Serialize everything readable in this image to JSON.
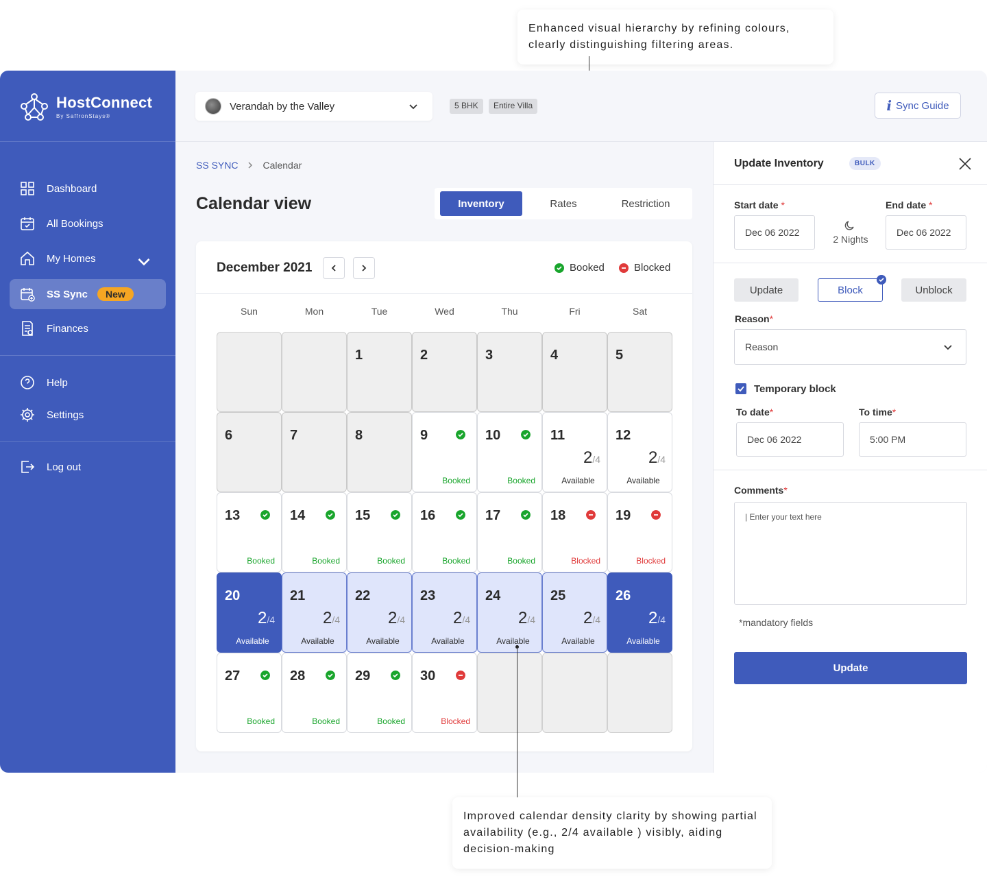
{
  "annotations": {
    "top": "Enhanced visual hierarchy by refining colours, clearly distinguishing filtering areas.",
    "bottom": "Improved calendar density clarity by showing partial availability (e.g., 2/4 available ) visibly, aiding decision-making"
  },
  "brand": {
    "name": "HostConnect",
    "sub": "By SaffronStays®"
  },
  "sidebar": {
    "items": [
      {
        "label": "Dashboard",
        "icon": "dashboard-icon"
      },
      {
        "label": "All Bookings",
        "icon": "calendar-check-icon"
      },
      {
        "label": "My Homes",
        "icon": "home-icon"
      },
      {
        "label": "SS Sync",
        "icon": "calendar-sync-icon",
        "badge": "New"
      },
      {
        "label": "Finances",
        "icon": "invoice-icon"
      },
      {
        "label": "Help",
        "icon": "help-icon"
      },
      {
        "label": "Settings",
        "icon": "gear-icon"
      },
      {
        "label": "Log out",
        "icon": "logout-icon"
      }
    ]
  },
  "topbar": {
    "property": "Verandah by the Valley",
    "tags": [
      "5 BHK",
      "Entire Villa"
    ],
    "sync_guide": "Sync Guide"
  },
  "breadcrumb": {
    "root": "SS SYNC",
    "current": "Calendar"
  },
  "page_title": "Calendar view",
  "tabs": [
    "Inventory",
    "Rates",
    "Restriction"
  ],
  "calendar": {
    "month": "December 2021",
    "legend": {
      "booked": "Booked",
      "blocked": "Blocked"
    },
    "weekdays": [
      "Sun",
      "Mon",
      "Tue",
      "Wed",
      "Thu",
      "Fri",
      "Sat"
    ],
    "cells": [
      {
        "t": "empty"
      },
      {
        "t": "empty"
      },
      {
        "t": "past",
        "d": "1"
      },
      {
        "t": "past",
        "d": "2"
      },
      {
        "t": "past",
        "d": "3"
      },
      {
        "t": "past",
        "d": "4"
      },
      {
        "t": "past",
        "d": "5"
      },
      {
        "t": "past",
        "d": "6"
      },
      {
        "t": "past",
        "d": "7"
      },
      {
        "t": "past",
        "d": "8"
      },
      {
        "t": "booked",
        "d": "9",
        "s": "Booked"
      },
      {
        "t": "booked",
        "d": "10",
        "s": "Booked"
      },
      {
        "t": "avail",
        "d": "11",
        "f": "2",
        "of": "4",
        "s": "Available"
      },
      {
        "t": "avail",
        "d": "12",
        "f": "2",
        "of": "4",
        "s": "Available"
      },
      {
        "t": "booked",
        "d": "13",
        "s": "Booked"
      },
      {
        "t": "booked",
        "d": "14",
        "s": "Booked"
      },
      {
        "t": "booked",
        "d": "15",
        "s": "Booked"
      },
      {
        "t": "booked",
        "d": "16",
        "s": "Booked"
      },
      {
        "t": "booked",
        "d": "17",
        "s": "Booked"
      },
      {
        "t": "blocked",
        "d": "18",
        "s": "Blocked"
      },
      {
        "t": "blocked",
        "d": "19",
        "s": "Blocked"
      },
      {
        "t": "seldark",
        "d": "20",
        "f": "2",
        "of": "4",
        "s": "Available"
      },
      {
        "t": "sellight",
        "d": "21",
        "f": "2",
        "of": "4",
        "s": "Available"
      },
      {
        "t": "sellight",
        "d": "22",
        "f": "2",
        "of": "4",
        "s": "Available"
      },
      {
        "t": "sellight",
        "d": "23",
        "f": "2",
        "of": "4",
        "s": "Available"
      },
      {
        "t": "sellight",
        "d": "24",
        "f": "2",
        "of": "4",
        "s": "Available"
      },
      {
        "t": "sellight",
        "d": "25",
        "f": "2",
        "of": "4",
        "s": "Available"
      },
      {
        "t": "seldark",
        "d": "26",
        "f": "2",
        "of": "4",
        "s": "Available"
      },
      {
        "t": "booked",
        "d": "27",
        "s": "Booked"
      },
      {
        "t": "booked",
        "d": "28",
        "s": "Booked"
      },
      {
        "t": "booked",
        "d": "29",
        "s": "Booked"
      },
      {
        "t": "blocked",
        "d": "30",
        "s": "Blocked"
      },
      {
        "t": "empty"
      },
      {
        "t": "empty"
      },
      {
        "t": "empty"
      }
    ]
  },
  "panel": {
    "title": "Update Inventory",
    "badge": "BULK",
    "start_label": "Start date",
    "start_value": "Dec 06 2022",
    "end_label": "End date",
    "end_value": "Dec 06 2022",
    "nights": "2 Nights",
    "actions": [
      "Update",
      "Block",
      "Unblock"
    ],
    "reason_label": "Reason",
    "reason_placeholder": "Reason",
    "temp_block": "Temporary block",
    "to_date_label": "To date",
    "to_date_value": "Dec 06 2022",
    "to_time_label": "To time",
    "to_time_value": "5:00 PM",
    "comments_label": "Comments",
    "comments_placeholder": "| Enter your text here",
    "mandatory_note": "*mandatory fields",
    "submit": "Update"
  },
  "colors": {
    "primary": "#3f5bbb",
    "booked": "#19a52c",
    "blocked": "#e03a3a",
    "badge": "#f6a623"
  }
}
